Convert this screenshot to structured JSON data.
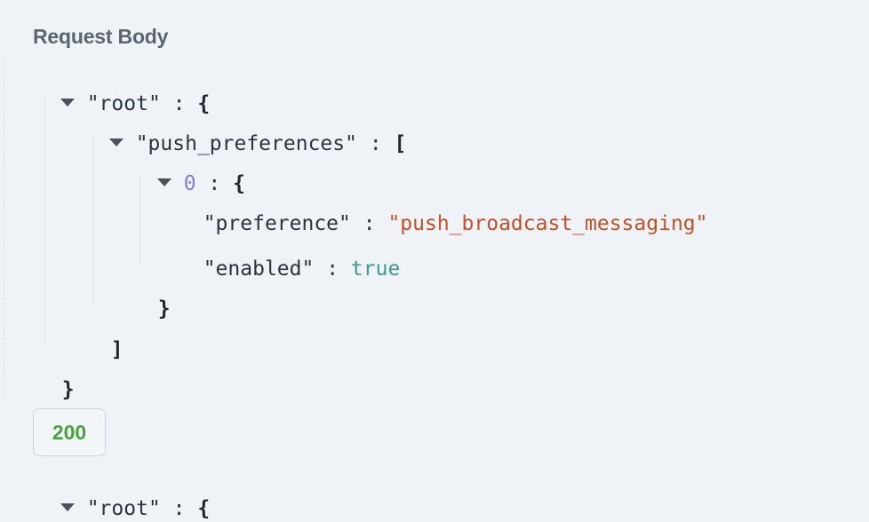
{
  "section": {
    "title": "Request Body"
  },
  "request": {
    "root_key": "\"root\"",
    "push_key": "\"push_preferences\"",
    "index": "0",
    "pref_key": "\"preference\"",
    "pref_value": "\"push_broadcast_messaging\"",
    "enabled_key": "\"enabled\"",
    "enabled_value": "true",
    "colon": ":",
    "open_brace": "{",
    "close_brace": "}",
    "open_bracket": "[",
    "close_bracket": "]"
  },
  "response": {
    "status_code": "200",
    "root_key": "\"root\"",
    "colon": ":",
    "open_brace": "{"
  },
  "colors": {
    "string": "#c1502a",
    "boolean": "#3f9a8e",
    "index": "#7b84c4",
    "status_ok": "#4aa23d"
  }
}
